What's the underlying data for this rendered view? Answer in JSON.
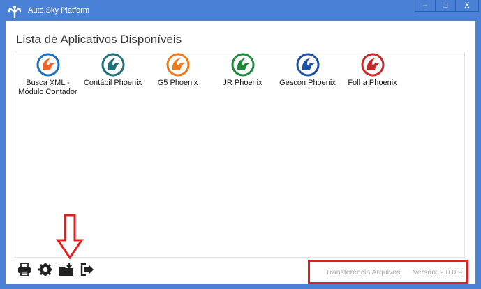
{
  "window": {
    "title": "Auto.Sky Platform",
    "minimize_label": "–",
    "maximize_label": "□",
    "close_label": "X"
  },
  "main": {
    "heading": "Lista de Aplicativos Disponíveis",
    "apps": [
      {
        "label": "Busca XML -\nMódulo Contador",
        "color": "#1a6fc0",
        "accent": "#f0642a"
      },
      {
        "label": "Contábil Phoenix",
        "color": "#1e6f78",
        "accent": "#1e6f78"
      },
      {
        "label": "G5 Phoenix",
        "color": "#f07a1a",
        "accent": "#f07a1a"
      },
      {
        "label": "JR Phoenix",
        "color": "#1f8a3a",
        "accent": "#1f8a3a"
      },
      {
        "label": "Gescon Phoenix",
        "color": "#1f50a8",
        "accent": "#1f50a8"
      },
      {
        "label": "Folha Phoenix",
        "color": "#c62828",
        "accent": "#c62828"
      }
    ]
  },
  "toolbar": {
    "icons": [
      "printer-icon",
      "gear-icon",
      "folder-download-icon",
      "exit-icon"
    ]
  },
  "status": {
    "transfer_label": "Transferência Arquivos",
    "version_label": "Versão: 2.0.0.9"
  },
  "colors": {
    "titlebar": "#4a80d6",
    "highlight": "#e31d1d"
  }
}
